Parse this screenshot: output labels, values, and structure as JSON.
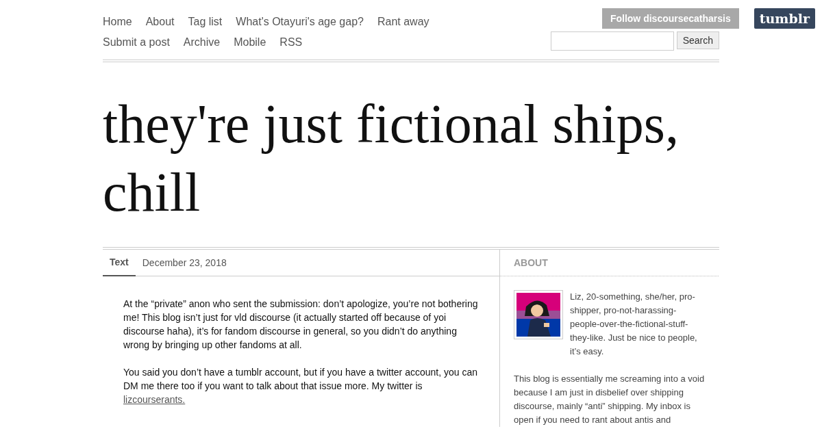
{
  "nav": {
    "items": [
      {
        "label": "Home"
      },
      {
        "label": "About"
      },
      {
        "label": "Tag list"
      },
      {
        "label": "What's Otayuri's age gap?"
      },
      {
        "label": "Rant away"
      },
      {
        "label": "Submit a post"
      },
      {
        "label": "Archive"
      },
      {
        "label": "Mobile"
      },
      {
        "label": "RSS"
      }
    ]
  },
  "search": {
    "button": "Search"
  },
  "follow_bar": {
    "follow": "Follow discoursecatharsis",
    "logo": "tumblr"
  },
  "blog_title": "they're just fictional ships, chill",
  "post": {
    "type_tab": "Text",
    "date": "December 23, 2018",
    "paragraphs": [
      {
        "text": "At the “private” anon who sent the submission: don’t apologize, you’re not bothering me! This blog isn’t just for vld discourse (it actually started off because of yoi discourse haha), it’s for fandom discourse in general, so you didn’t do anything wrong by bringing up other fandoms at all."
      },
      {
        "text": "You said you don’t have a tumblr account, but if you have a twitter account, you can DM me there too if you want to talk about that issue more. My twitter is",
        "link": "lizcourserants. "
      }
    ]
  },
  "sidebar": {
    "heading": "ABOUT",
    "paragraphs": [
      "Liz, 20-something, she/her, pro-shipper, pro-not-harassing-people-over-the-fictional-stuff-they-like. Just be nice to people, it’s easy.",
      "This blog is essentially me screaming into a void because I am just in disbelief over shipping discourse, mainly “anti” shipping. My inbox is open if you need to rant about antis and"
    ]
  }
}
